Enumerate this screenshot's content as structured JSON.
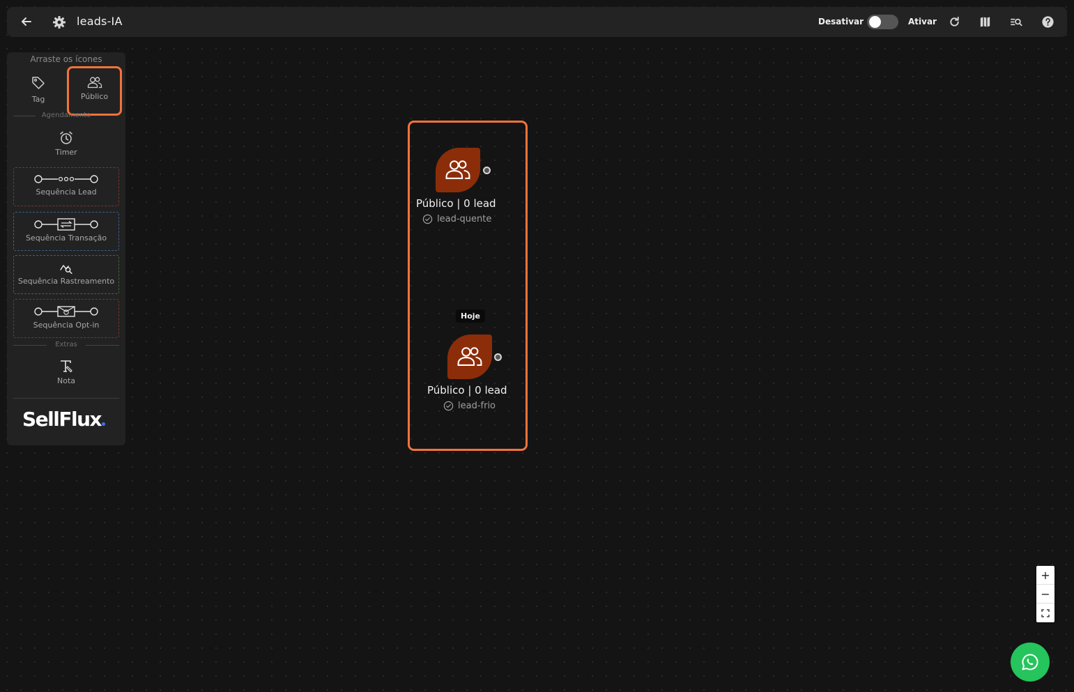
{
  "header": {
    "title": "leads-IA",
    "deactivate_label": "Desativar",
    "activate_label": "Ativar",
    "toggle_state": "off"
  },
  "sidebar": {
    "hint": "Arraste os ícones",
    "tools": {
      "tag": "Tag",
      "publico": "Público",
      "timer": "Timer",
      "nota": "Nota"
    },
    "sections": {
      "agendamento": "Agendamento",
      "extras": "Extras"
    },
    "sequences": {
      "lead": "Sequência Lead",
      "transacao": "Sequência Transação",
      "rastreamento": "Sequência Rastreamento",
      "optin": "Sequência Opt-in"
    },
    "brand": "SellFlux"
  },
  "canvas": {
    "nodes": [
      {
        "title": "Público | 0 lead",
        "tag": "lead-quente"
      },
      {
        "title": "Público | 0 lead",
        "tag": "lead-frio"
      }
    ],
    "badge": "Hoje"
  },
  "zoom_controls": {
    "in": "+",
    "out": "−"
  },
  "colors": {
    "accent": "#f2733a",
    "node_fill": "#8c2d0a",
    "whatsapp": "#25c45c",
    "background": "#141414"
  }
}
